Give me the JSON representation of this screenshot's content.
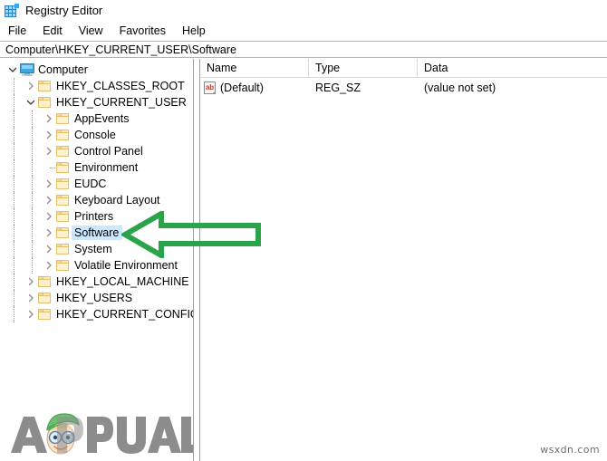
{
  "window": {
    "title": "Registry Editor",
    "icon": "registry-editor-icon"
  },
  "menu": {
    "items": [
      {
        "label": "File"
      },
      {
        "label": "Edit"
      },
      {
        "label": "View"
      },
      {
        "label": "Favorites"
      },
      {
        "label": "Help"
      }
    ]
  },
  "address_bar": {
    "path": "Computer\\HKEY_CURRENT_USER\\Software"
  },
  "tree": {
    "nodes": [
      {
        "label": "Computer",
        "depth": 0,
        "icon": "computer-monitor-icon",
        "expander": "expanded",
        "selected": false
      },
      {
        "label": "HKEY_CLASSES_ROOT",
        "depth": 1,
        "icon": "folder-icon",
        "expander": "collapsed",
        "selected": false
      },
      {
        "label": "HKEY_CURRENT_USER",
        "depth": 1,
        "icon": "folder-icon",
        "expander": "expanded",
        "selected": false
      },
      {
        "label": "AppEvents",
        "depth": 2,
        "icon": "folder-icon",
        "expander": "collapsed",
        "selected": false
      },
      {
        "label": "Console",
        "depth": 2,
        "icon": "folder-icon",
        "expander": "collapsed",
        "selected": false
      },
      {
        "label": "Control Panel",
        "depth": 2,
        "icon": "folder-icon",
        "expander": "collapsed",
        "selected": false
      },
      {
        "label": "Environment",
        "depth": 2,
        "icon": "folder-icon",
        "expander": "none",
        "selected": false
      },
      {
        "label": "EUDC",
        "depth": 2,
        "icon": "folder-icon",
        "expander": "collapsed",
        "selected": false
      },
      {
        "label": "Keyboard Layout",
        "depth": 2,
        "icon": "folder-icon",
        "expander": "collapsed",
        "selected": false
      },
      {
        "label": "Printers",
        "depth": 2,
        "icon": "folder-icon",
        "expander": "collapsed",
        "selected": false
      },
      {
        "label": "Software",
        "depth": 2,
        "icon": "folder-icon",
        "expander": "collapsed",
        "selected": true
      },
      {
        "label": "System",
        "depth": 2,
        "icon": "folder-icon",
        "expander": "collapsed",
        "selected": false
      },
      {
        "label": "Volatile Environment",
        "depth": 2,
        "icon": "folder-icon",
        "expander": "collapsed",
        "selected": false
      },
      {
        "label": "HKEY_LOCAL_MACHINE",
        "depth": 1,
        "icon": "folder-icon",
        "expander": "collapsed",
        "selected": false
      },
      {
        "label": "HKEY_USERS",
        "depth": 1,
        "icon": "folder-icon",
        "expander": "collapsed",
        "selected": false
      },
      {
        "label": "HKEY_CURRENT_CONFIG",
        "depth": 1,
        "icon": "folder-icon",
        "expander": "collapsed",
        "selected": false
      }
    ]
  },
  "value_list": {
    "columns": [
      {
        "label": "Name"
      },
      {
        "label": "Type"
      },
      {
        "label": "Data"
      }
    ],
    "rows": [
      {
        "icon": "string-value-ab-icon",
        "name": "(Default)",
        "type": "REG_SZ",
        "data": "(value not set)"
      }
    ]
  },
  "annotation": {
    "arrow": {
      "name": "green-left-arrow-annotation",
      "direction": "left",
      "color": "#2aa34a",
      "points_at": "Software"
    }
  },
  "watermarks": {
    "logo_text": "PPUALS",
    "logo_lead_letter": "A",
    "logo_color": "#8c8c8c",
    "site": "wsxdn.com"
  },
  "colors": {
    "selection": "#cce8ff",
    "arrow_green": "#2aa34a",
    "folder": "#fde8b0",
    "accent_blue": "#1e88d4"
  }
}
